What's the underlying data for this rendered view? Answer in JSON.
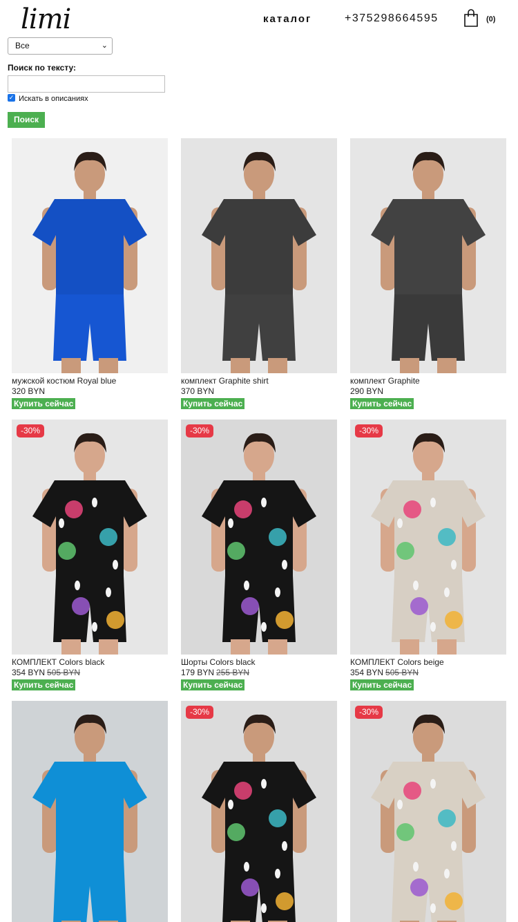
{
  "header": {
    "logo": "limi",
    "nav_catalog": "каталог",
    "phone": "+375298664595",
    "cart_count": "(0)"
  },
  "filter": {
    "category_selected": "Все",
    "search_label": "Поиск по тексту:",
    "search_value": "",
    "search_in_descriptions_label": "Искать в описаниях",
    "search_in_descriptions_checked": true,
    "search_button": "Поиск"
  },
  "buy_label": "Купить сейчас",
  "products": [
    {
      "name": "мужской костюм Royal blue",
      "price": "320 BYN",
      "old_price": "",
      "badge": "",
      "style": "royal-blue"
    },
    {
      "name": "комплект Graphite shirt",
      "price": "370 BYN",
      "old_price": "",
      "badge": "",
      "style": "graphite-shirt"
    },
    {
      "name": "комплект Graphite",
      "price": "290 BYN",
      "old_price": "",
      "badge": "",
      "style": "graphite"
    },
    {
      "name": "КОМПЛЕКТ Colors black",
      "price": "354 BYN",
      "old_price": "505 BYN",
      "badge": "-30%",
      "style": "colors-black"
    },
    {
      "name": "Шорты Colors black",
      "price": "179 BYN",
      "old_price": "255 BYN",
      "badge": "-30%",
      "style": "shorts-black"
    },
    {
      "name": "КОМПЛЕКТ Colors beige",
      "price": "354 BYN",
      "old_price": "505 BYN",
      "badge": "-30%",
      "style": "colors-beige"
    },
    {
      "name": "",
      "price": "",
      "old_price": "",
      "badge": "",
      "style": "sky-blue"
    },
    {
      "name": "",
      "price": "",
      "old_price": "",
      "badge": "-30%",
      "style": "colors-black-men"
    },
    {
      "name": "",
      "price": "",
      "old_price": "",
      "badge": "-30%",
      "style": "colors-beige-men"
    }
  ],
  "colors": {
    "button_green": "#4caf50",
    "badge_red": "#e63946"
  }
}
